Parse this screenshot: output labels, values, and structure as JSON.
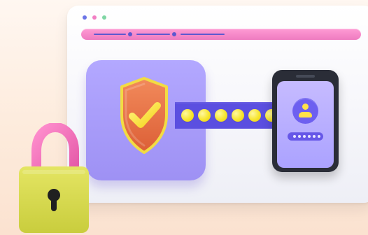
{
  "colors": {
    "background": "#fdebdc",
    "window": "#f7f7fb",
    "address_bar": "#ff8fcf",
    "panel_purple": "#a79af7",
    "accent_blue": "#5b4fe0",
    "yellow": "#f7e52e",
    "orange": "#e46b42",
    "phone_dark": "#2a2d37",
    "lock_body": "#d9dc57",
    "lock_shackle": "#f06ab4"
  },
  "icons": {
    "shield": "shield-check-icon",
    "user": "user-avatar-icon",
    "lock": "padlock-icon"
  }
}
